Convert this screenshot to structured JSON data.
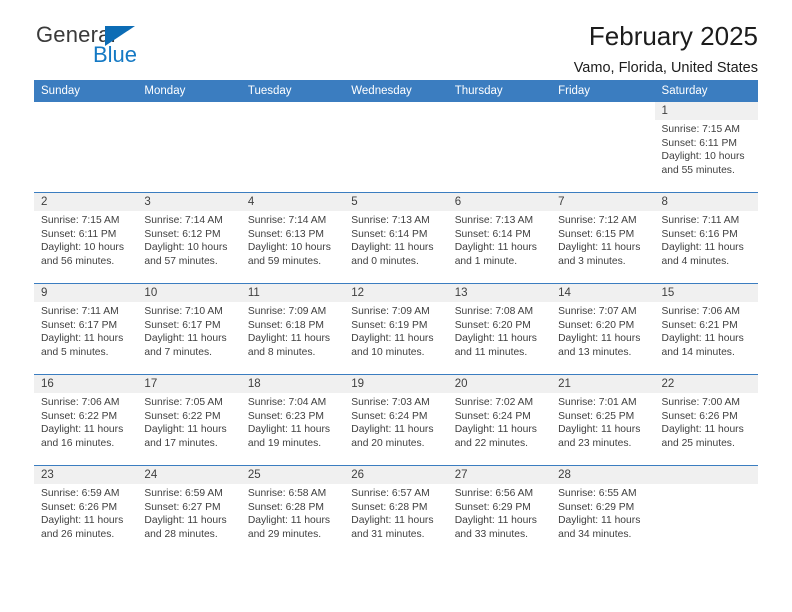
{
  "brand": {
    "name_part1": "General",
    "name_part2": "Blue",
    "triangle_icon": "triangle-icon",
    "accent_color": "#1479c4",
    "logo_blue": "#0c6cb5"
  },
  "header": {
    "title": "February 2025",
    "subtitle": "Vamo, Florida, United States"
  },
  "calendar": {
    "header_bg": "#3b7dc0",
    "daynum_bg": "#f0f0f0",
    "weekday_headers": [
      "Sunday",
      "Monday",
      "Tuesday",
      "Wednesday",
      "Thursday",
      "Friday",
      "Saturday"
    ],
    "weeks": [
      [
        {
          "day": "",
          "blank": true
        },
        {
          "day": "",
          "blank": true
        },
        {
          "day": "",
          "blank": true
        },
        {
          "day": "",
          "blank": true
        },
        {
          "day": "",
          "blank": true
        },
        {
          "day": "",
          "blank": true
        },
        {
          "day": "1",
          "sunrise": "Sunrise: 7:15 AM",
          "sunset": "Sunset: 6:11 PM",
          "daylight_line1": "Daylight: 10 hours",
          "daylight_line2": "and 55 minutes."
        }
      ],
      [
        {
          "day": "2",
          "sunrise": "Sunrise: 7:15 AM",
          "sunset": "Sunset: 6:11 PM",
          "daylight_line1": "Daylight: 10 hours",
          "daylight_line2": "and 56 minutes."
        },
        {
          "day": "3",
          "sunrise": "Sunrise: 7:14 AM",
          "sunset": "Sunset: 6:12 PM",
          "daylight_line1": "Daylight: 10 hours",
          "daylight_line2": "and 57 minutes."
        },
        {
          "day": "4",
          "sunrise": "Sunrise: 7:14 AM",
          "sunset": "Sunset: 6:13 PM",
          "daylight_line1": "Daylight: 10 hours",
          "daylight_line2": "and 59 minutes."
        },
        {
          "day": "5",
          "sunrise": "Sunrise: 7:13 AM",
          "sunset": "Sunset: 6:14 PM",
          "daylight_line1": "Daylight: 11 hours",
          "daylight_line2": "and 0 minutes."
        },
        {
          "day": "6",
          "sunrise": "Sunrise: 7:13 AM",
          "sunset": "Sunset: 6:14 PM",
          "daylight_line1": "Daylight: 11 hours",
          "daylight_line2": "and 1 minute."
        },
        {
          "day": "7",
          "sunrise": "Sunrise: 7:12 AM",
          "sunset": "Sunset: 6:15 PM",
          "daylight_line1": "Daylight: 11 hours",
          "daylight_line2": "and 3 minutes."
        },
        {
          "day": "8",
          "sunrise": "Sunrise: 7:11 AM",
          "sunset": "Sunset: 6:16 PM",
          "daylight_line1": "Daylight: 11 hours",
          "daylight_line2": "and 4 minutes."
        }
      ],
      [
        {
          "day": "9",
          "sunrise": "Sunrise: 7:11 AM",
          "sunset": "Sunset: 6:17 PM",
          "daylight_line1": "Daylight: 11 hours",
          "daylight_line2": "and 5 minutes."
        },
        {
          "day": "10",
          "sunrise": "Sunrise: 7:10 AM",
          "sunset": "Sunset: 6:17 PM",
          "daylight_line1": "Daylight: 11 hours",
          "daylight_line2": "and 7 minutes."
        },
        {
          "day": "11",
          "sunrise": "Sunrise: 7:09 AM",
          "sunset": "Sunset: 6:18 PM",
          "daylight_line1": "Daylight: 11 hours",
          "daylight_line2": "and 8 minutes."
        },
        {
          "day": "12",
          "sunrise": "Sunrise: 7:09 AM",
          "sunset": "Sunset: 6:19 PM",
          "daylight_line1": "Daylight: 11 hours",
          "daylight_line2": "and 10 minutes."
        },
        {
          "day": "13",
          "sunrise": "Sunrise: 7:08 AM",
          "sunset": "Sunset: 6:20 PM",
          "daylight_line1": "Daylight: 11 hours",
          "daylight_line2": "and 11 minutes."
        },
        {
          "day": "14",
          "sunrise": "Sunrise: 7:07 AM",
          "sunset": "Sunset: 6:20 PM",
          "daylight_line1": "Daylight: 11 hours",
          "daylight_line2": "and 13 minutes."
        },
        {
          "day": "15",
          "sunrise": "Sunrise: 7:06 AM",
          "sunset": "Sunset: 6:21 PM",
          "daylight_line1": "Daylight: 11 hours",
          "daylight_line2": "and 14 minutes."
        }
      ],
      [
        {
          "day": "16",
          "sunrise": "Sunrise: 7:06 AM",
          "sunset": "Sunset: 6:22 PM",
          "daylight_line1": "Daylight: 11 hours",
          "daylight_line2": "and 16 minutes."
        },
        {
          "day": "17",
          "sunrise": "Sunrise: 7:05 AM",
          "sunset": "Sunset: 6:22 PM",
          "daylight_line1": "Daylight: 11 hours",
          "daylight_line2": "and 17 minutes."
        },
        {
          "day": "18",
          "sunrise": "Sunrise: 7:04 AM",
          "sunset": "Sunset: 6:23 PM",
          "daylight_line1": "Daylight: 11 hours",
          "daylight_line2": "and 19 minutes."
        },
        {
          "day": "19",
          "sunrise": "Sunrise: 7:03 AM",
          "sunset": "Sunset: 6:24 PM",
          "daylight_line1": "Daylight: 11 hours",
          "daylight_line2": "and 20 minutes."
        },
        {
          "day": "20",
          "sunrise": "Sunrise: 7:02 AM",
          "sunset": "Sunset: 6:24 PM",
          "daylight_line1": "Daylight: 11 hours",
          "daylight_line2": "and 22 minutes."
        },
        {
          "day": "21",
          "sunrise": "Sunrise: 7:01 AM",
          "sunset": "Sunset: 6:25 PM",
          "daylight_line1": "Daylight: 11 hours",
          "daylight_line2": "and 23 minutes."
        },
        {
          "day": "22",
          "sunrise": "Sunrise: 7:00 AM",
          "sunset": "Sunset: 6:26 PM",
          "daylight_line1": "Daylight: 11 hours",
          "daylight_line2": "and 25 minutes."
        }
      ],
      [
        {
          "day": "23",
          "sunrise": "Sunrise: 6:59 AM",
          "sunset": "Sunset: 6:26 PM",
          "daylight_line1": "Daylight: 11 hours",
          "daylight_line2": "and 26 minutes."
        },
        {
          "day": "24",
          "sunrise": "Sunrise: 6:59 AM",
          "sunset": "Sunset: 6:27 PM",
          "daylight_line1": "Daylight: 11 hours",
          "daylight_line2": "and 28 minutes."
        },
        {
          "day": "25",
          "sunrise": "Sunrise: 6:58 AM",
          "sunset": "Sunset: 6:28 PM",
          "daylight_line1": "Daylight: 11 hours",
          "daylight_line2": "and 29 minutes."
        },
        {
          "day": "26",
          "sunrise": "Sunrise: 6:57 AM",
          "sunset": "Sunset: 6:28 PM",
          "daylight_line1": "Daylight: 11 hours",
          "daylight_line2": "and 31 minutes."
        },
        {
          "day": "27",
          "sunrise": "Sunrise: 6:56 AM",
          "sunset": "Sunset: 6:29 PM",
          "daylight_line1": "Daylight: 11 hours",
          "daylight_line2": "and 33 minutes."
        },
        {
          "day": "28",
          "sunrise": "Sunrise: 6:55 AM",
          "sunset": "Sunset: 6:29 PM",
          "daylight_line1": "Daylight: 11 hours",
          "daylight_line2": "and 34 minutes."
        },
        {
          "day": "",
          "empty": true
        }
      ]
    ]
  }
}
